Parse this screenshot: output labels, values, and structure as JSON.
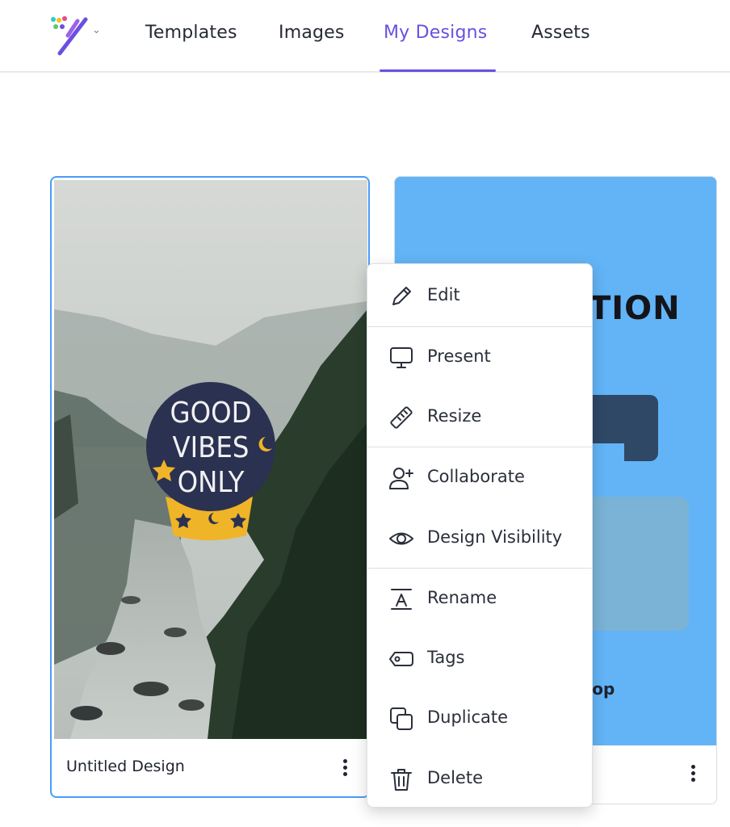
{
  "nav": {
    "tabs": [
      {
        "label": "Templates"
      },
      {
        "label": "Images"
      },
      {
        "label": "My Designs"
      },
      {
        "label": "Assets"
      }
    ],
    "active_tab": "My Designs",
    "accent": "#6b4fe0"
  },
  "designs": [
    {
      "title": "Untitled Design",
      "badge_text": [
        "GOOD",
        "VIBES",
        "ONLY"
      ]
    },
    {
      "heading_fragment": "TION",
      "sub_fragment": "hop"
    }
  ],
  "context_menu": {
    "items": [
      {
        "label": "Edit",
        "icon": "pencil-icon"
      },
      {
        "label": "Present",
        "icon": "monitor-icon"
      },
      {
        "label": "Resize",
        "icon": "ruler-icon"
      },
      {
        "label": "Collaborate",
        "icon": "user-plus-icon"
      },
      {
        "label": "Design Visibility",
        "icon": "eye-icon"
      },
      {
        "label": "Rename",
        "icon": "rename-icon"
      },
      {
        "label": "Tags",
        "icon": "tag-icon"
      },
      {
        "label": "Duplicate",
        "icon": "duplicate-icon"
      },
      {
        "label": "Delete",
        "icon": "trash-icon"
      }
    ]
  },
  "colors": {
    "selected_border": "#4a9df8",
    "card2_background": "#62b4f6",
    "badge_background": "#2b3150",
    "badge_accent": "#f0b428"
  }
}
